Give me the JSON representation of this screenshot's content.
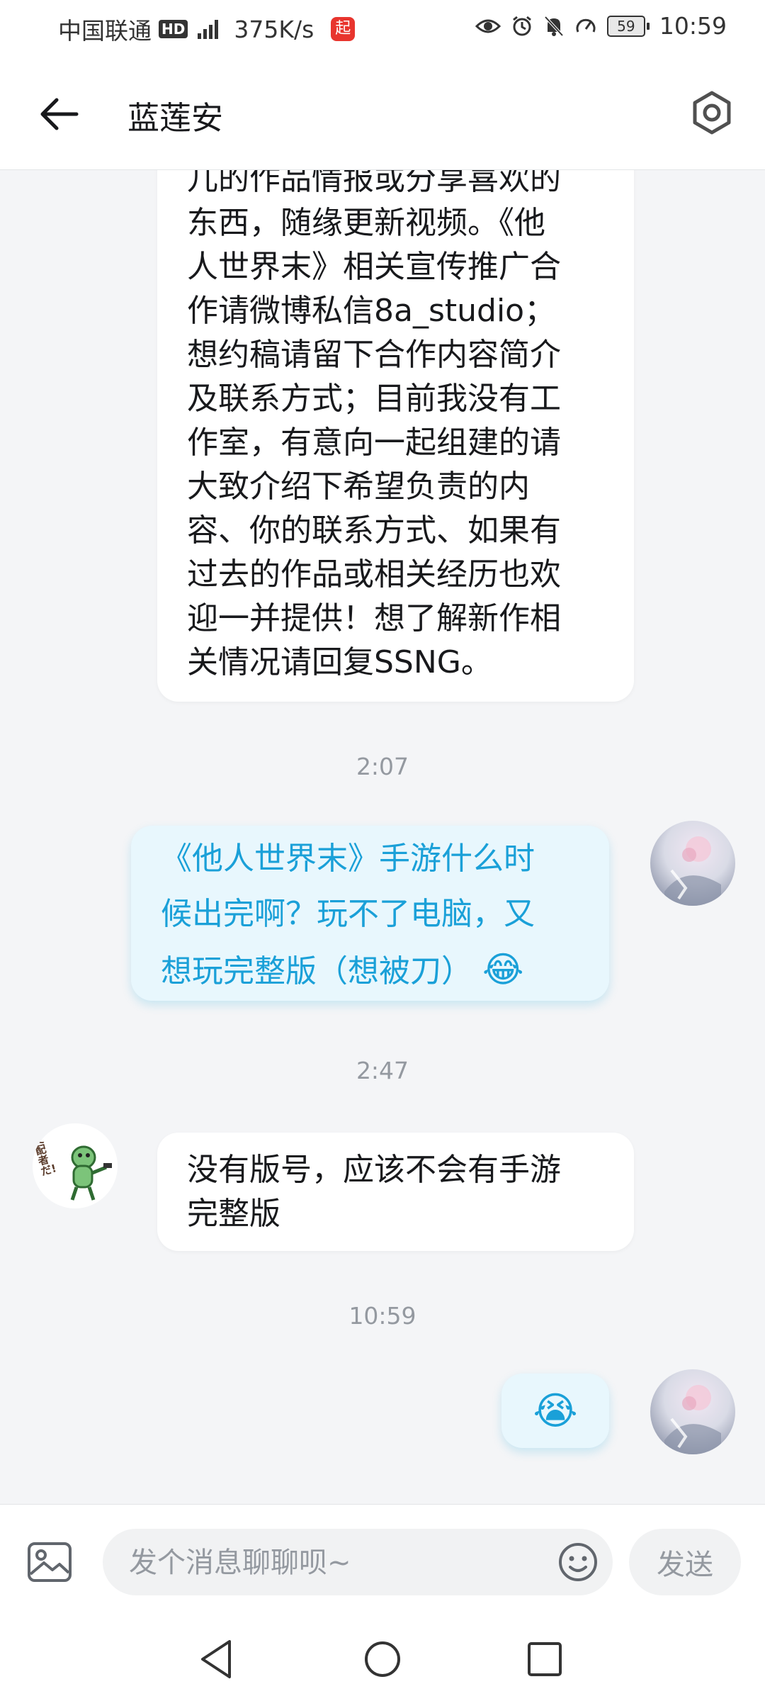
{
  "status_bar": {
    "carrier": "中国联通",
    "hd": "HD",
    "speed": "375K/s",
    "app_badge": "起",
    "battery": "59",
    "time": "10:59"
  },
  "header": {
    "title": "蓝莲安"
  },
  "messages": [
    {
      "from": "other",
      "lines": [
        "儿的作品情报或分享喜欢的",
        "东西，随缘更新视频。《他",
        "人世界末》相关宣传推广合",
        "作请微博私信8a_studio；",
        "想约稿请留下合作内容简介",
        "及联系方式；目前我没有工",
        "作室，有意向一起组建的请",
        "大致介绍下希望负责的内",
        "容、你的联系方式、如果有",
        "过去的作品或相关经历也欢",
        "迎一并提供！想了解新作相",
        "关情况请回复SSNG。"
      ]
    },
    {
      "time": "2:07"
    },
    {
      "from": "self",
      "lines": [
        "《他人世界末》手游什么时",
        "候出完啊？玩不了电脑，又",
        "想玩完整版（想被刀）"
      ],
      "emoji": "😂"
    },
    {
      "time": "2:47"
    },
    {
      "from": "other",
      "lines": [
        "没有版号，应该不会有手游",
        "完整版"
      ]
    },
    {
      "time": "10:59"
    },
    {
      "from": "self",
      "emoji": "😭"
    }
  ],
  "avatar_other_text": "支配者だ!",
  "composer": {
    "placeholder": "发个消息聊聊呗~",
    "send_label": "发送"
  },
  "colors": {
    "accent": "#1aa0d8",
    "bubble_out": "#e8f7fd",
    "bubble_in": "#ffffff",
    "background": "#f4f5f7"
  }
}
